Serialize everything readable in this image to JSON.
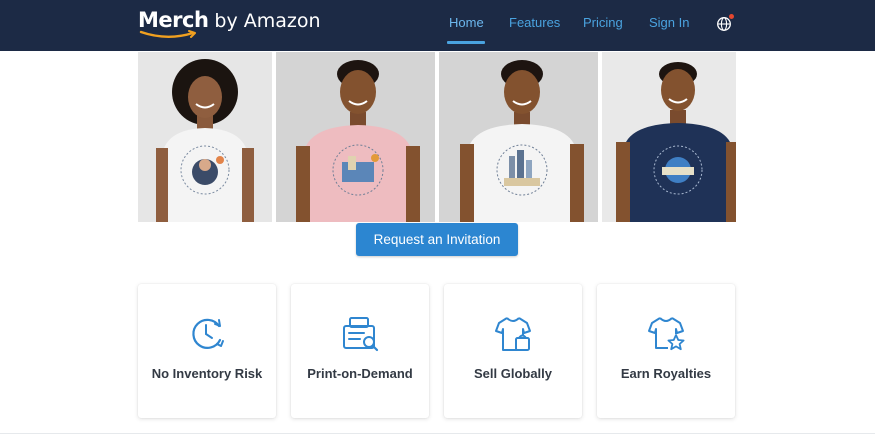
{
  "header": {
    "logo_merch": "Merch",
    "logo_rest": "by Amazon",
    "nav": [
      {
        "label": "Home",
        "active": true
      },
      {
        "label": "Features",
        "active": false
      },
      {
        "label": "Pricing",
        "active": false
      },
      {
        "label": "Sign In",
        "active": false
      }
    ],
    "language_icon": "globe-icon"
  },
  "hero": {
    "photos": [
      {
        "shirt_color": "white",
        "design": "portrait graphic"
      },
      {
        "shirt_color": "pink",
        "design": "city graphic"
      },
      {
        "shirt_color": "white",
        "design": "skyline graphic"
      },
      {
        "shirt_color": "navy",
        "design": "city graphic"
      }
    ],
    "cta_label": "Request an Invitation"
  },
  "features": [
    {
      "icon": "clock-refresh-icon",
      "label": "No Inventory Risk"
    },
    {
      "icon": "printer-search-icon",
      "label": "Print-on-Demand"
    },
    {
      "icon": "shirt-bag-icon",
      "label": "Sell Globally"
    },
    {
      "icon": "shirt-star-icon",
      "label": "Earn Royalties"
    }
  ],
  "colors": {
    "header_bg": "#1c2a45",
    "accent": "#2c86d1",
    "nav_text": "#4aa3e0",
    "icon_blue": "#2f86d0"
  }
}
